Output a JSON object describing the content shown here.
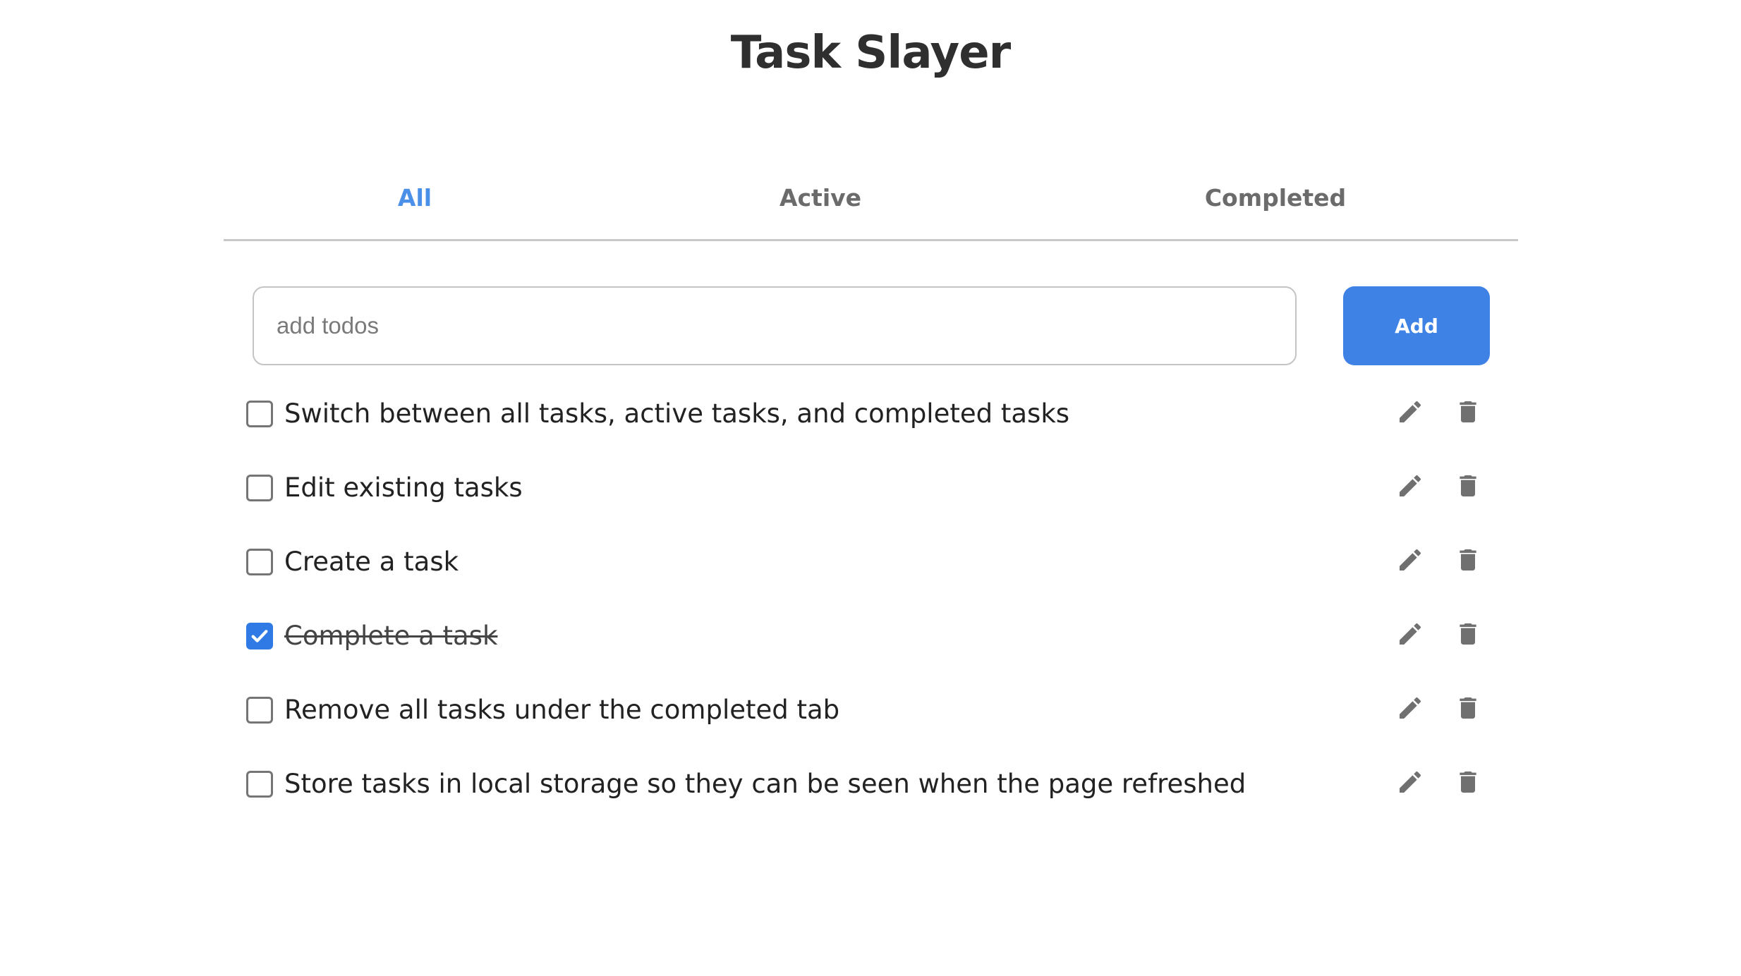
{
  "app": {
    "title": "Task Slayer"
  },
  "tabs": [
    {
      "label": "All",
      "active": true
    },
    {
      "label": "Active",
      "active": false
    },
    {
      "label": "Completed",
      "active": false
    }
  ],
  "input": {
    "value": "",
    "placeholder": "add todos"
  },
  "add_button": {
    "label": "Add"
  },
  "todos": [
    {
      "text": "Switch between all tasks, active tasks, and completed tasks",
      "completed": false
    },
    {
      "text": "Edit existing tasks",
      "completed": false
    },
    {
      "text": "Create a task",
      "completed": false
    },
    {
      "text": "Complete a task",
      "completed": true
    },
    {
      "text": "Remove all tasks under the completed tab",
      "completed": false
    },
    {
      "text": "Store tasks in local storage so they can be seen when the page refreshed",
      "completed": false
    }
  ],
  "icons": {
    "edit": "pencil-icon",
    "delete": "trash-icon",
    "checkmark": "checkmark-icon"
  },
  "colors": {
    "accent": "#3e82e6",
    "active_tab": "#4a8fe8",
    "inactive_tab": "#6b6b6b",
    "icon": "#707070"
  }
}
